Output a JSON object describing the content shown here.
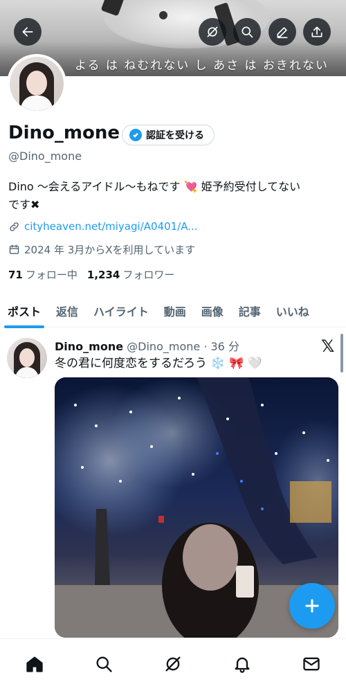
{
  "banner": {
    "text": "よる は ねむれない し あさ は おきれない"
  },
  "header_buttons": {
    "back": "back-arrow-icon",
    "grok": "grok-icon",
    "search": "search-icon",
    "edit": "pencil-icon",
    "share": "share-icon"
  },
  "profile": {
    "name": "Dino_mone",
    "verify_label": "認証を受ける",
    "handle": "@Dino_mone",
    "bio_line1": "Dino 〜会えるアイドル〜もねです 💘 姫予約受付してない",
    "bio_line2": "です✖",
    "link": "cityheaven.net/miyagi/A0401/A...",
    "joined": "2024 年 3月からXを利用しています",
    "following_count": "71",
    "following_label": "フォロー中",
    "followers_count": "1,234",
    "followers_label": "フォロワー"
  },
  "tabs": [
    "ポスト",
    "返信",
    "ハイライト",
    "動画",
    "画像",
    "記事",
    "いいね"
  ],
  "post": {
    "name": "Dino_mone",
    "handle": "@Dino_mone",
    "sep": "·",
    "time": "36 分",
    "text": "冬の君に何度恋をするだろう",
    "emoji_snow": "❄️",
    "emoji_ribbon": "🎀",
    "emoji_heart": "🤍"
  },
  "colors": {
    "accent": "#1d9bf0",
    "text": "#0f1419",
    "secondary": "#536471"
  }
}
